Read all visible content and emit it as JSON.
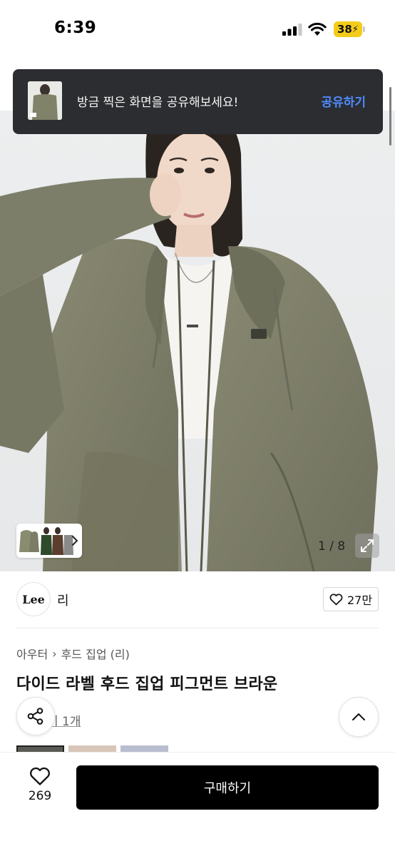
{
  "status_bar": {
    "time": "6:39",
    "battery": "38",
    "icons": [
      "cellular-signal-icon",
      "wifi-icon",
      "battery-charging-icon"
    ]
  },
  "toast": {
    "message": "방금 찍은 화면을 공유해보세요!",
    "action": "공유하기",
    "action_color": "#4f8bff"
  },
  "gallery": {
    "counter": "1 / 8",
    "current": 1,
    "total": 8,
    "icons": [
      "chevron-right-icon",
      "expand-icon"
    ]
  },
  "brand": {
    "logo_text": "Lee",
    "name": "리",
    "likes": "27만"
  },
  "product": {
    "breadcrumb": [
      "아우터",
      "후드 집업 (리)"
    ],
    "title": "다이드 라벨 후드 집업 피그먼트 브라운",
    "review_link": "기 1개"
  },
  "bottom_bar": {
    "wish_count": "269",
    "buy_label": "구매하기"
  },
  "colors": {
    "accent": "#4f8bff",
    "buy_button": "#000000",
    "toast_bg": "#2b2d30",
    "battery": "#f3cc1a"
  }
}
